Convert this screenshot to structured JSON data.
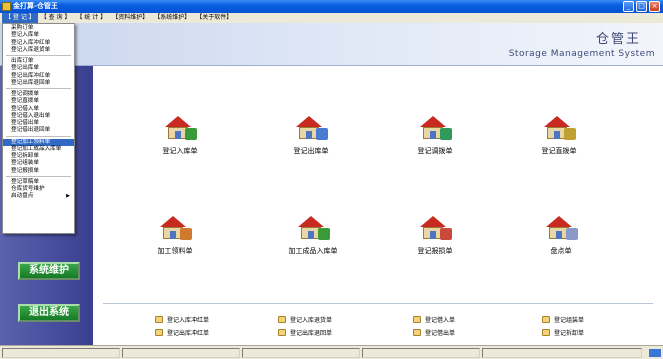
{
  "window": {
    "title": "金打算-仓管王",
    "buttons": [
      "_",
      "□",
      "×"
    ]
  },
  "menubar": [
    {
      "label": "【 登 记 】",
      "active": true
    },
    {
      "label": "【 查 询 】",
      "active": false
    },
    {
      "label": "【 统 计 】",
      "active": false
    },
    {
      "label": "【资料维护】",
      "active": false
    },
    {
      "label": "【系统维护】",
      "active": false
    },
    {
      "label": "【关于软件】",
      "active": false
    }
  ],
  "banner": {
    "brand_cn": "仓管王",
    "brand_en": "Storage Management System"
  },
  "sidebar": {
    "buttons": [
      "系统维护",
      "退出系统"
    ]
  },
  "dropdown": {
    "groups": [
      [
        "采购订单",
        "登记入库单",
        "登记入库冲红单",
        "登记入库退货单"
      ],
      [
        "出库订单",
        "登记出库单",
        "登记出库冲红单",
        "登记出库退回单"
      ],
      [
        "登记调拨单",
        "登记直拨单",
        "登记借入单",
        "登记借入退出单",
        "登记借出单",
        "登记借出退回单"
      ],
      [
        "登记加工领料单",
        "登记加工成品入库单",
        "登记拆卸单",
        "登记组装单",
        "登记报损单"
      ],
      [
        "登记草稿单",
        "仓库货号维护",
        "启动盘点"
      ]
    ],
    "highlighted": "登记加工领料单",
    "submenu_item": "启动盘点",
    "submenu_arrow": "▶"
  },
  "tiles": [
    {
      "label": "登记入库单",
      "badge_color": "#3a9a3a"
    },
    {
      "label": "登记出库单",
      "badge_color": "#4a7bd0"
    },
    {
      "label": "登记调拨单",
      "badge_color": "#2f9a5a"
    },
    {
      "label": "登记直拨单",
      "badge_color": "#c0a030"
    },
    {
      "label": "加工领料单",
      "badge_color": "#d07a30"
    },
    {
      "label": "加工成品入库单",
      "badge_color": "#3a9a3a"
    },
    {
      "label": "登记报损单",
      "badge_color": "#c84a3a"
    },
    {
      "label": "盘点单",
      "badge_color": "#8a9ac8"
    }
  ],
  "links": [
    "登记入库冲红单",
    "登记出库冲红单",
    "登记入库退货单",
    "登记出库退回单",
    "登记借入单",
    "登记借出单",
    "登记组装单",
    "登记拆卸单"
  ],
  "colors": {
    "accent": "#316ac5",
    "titlebar": "#0a5ee0",
    "sidebar": "#3a3f8e",
    "side_button": "#157a24"
  }
}
